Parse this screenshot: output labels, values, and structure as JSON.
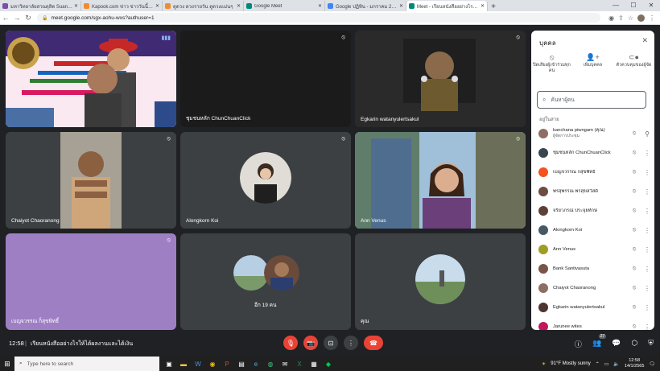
{
  "browser": {
    "tabs": [
      {
        "label": "มหาวิทยาลัยสวนดุสิต Suan Dusit Un",
        "color": "#7b4dad",
        "active": false
      },
      {
        "label": "Kapook.com ข่าว ข่าววันนี้ ดูดวง",
        "color": "#f28b30",
        "active": false
      },
      {
        "label": "ดูดวง ดวงรายวัน ดูดวงแม่นๆ",
        "color": "#f28b30",
        "active": false
      },
      {
        "label": "Google Meet",
        "color": "#00897b",
        "active": false
      },
      {
        "label": "Google ปฏิทิน - มกราคม 2022",
        "color": "#4285f4",
        "active": false
      },
      {
        "label": "Meet - เรียนหนังสืออย่างไรให้ได้ผล",
        "color": "#00897b",
        "active": true
      }
    ],
    "url": "meet.google.com/sgx-aohu-wxs?authuser=1"
  },
  "meeting": {
    "tiles": [
      {
        "name": "",
        "muted": false
      },
      {
        "name": "ชุมชนหลัก ChunChuanClick",
        "muted": true
      },
      {
        "name": "Egkarin watanyulertsakul",
        "muted": true
      },
      {
        "name": "Chaiyot Chaoranong",
        "muted": true
      },
      {
        "name": "Alongkorn Koi",
        "muted": true
      },
      {
        "name": "Ann Venus",
        "muted": true
      },
      {
        "name": "เบญจวรรณ ก็สุขพิทธิ์",
        "muted": true
      },
      {
        "name": "อีก 19 คน",
        "muted": false
      },
      {
        "name": "คุณ",
        "muted": false
      }
    ],
    "time": "12:58",
    "separator": "|",
    "title": "เรียนหนังสืออย่างไรให้ได้ผลงานและได้เงิน",
    "participant_count": "27"
  },
  "panel": {
    "title": "บุคคล",
    "actions": [
      {
        "icon": "mute-all-icon",
        "label": "ปิดเสียงผู้เข้าร่วมทุกคน"
      },
      {
        "icon": "add-person-icon",
        "label": "เพิ่มบุคคล"
      },
      {
        "icon": "host-controls-icon",
        "label": "ตัวควบคุมของผู้จัด"
      }
    ],
    "search_placeholder": "ค้นหาผู้คน",
    "section_label": "อยู่ในสาย",
    "participants": [
      {
        "name": "kanchana piwngam (คุณ)",
        "sub": "ผู้จัดการประชุม",
        "color": "#8d6e63",
        "icon": "pin-icon"
      },
      {
        "name": "ชุมชนหลัก ChunChuanClick",
        "sub": "",
        "color": "#37474f",
        "icon": "more-icon"
      },
      {
        "name": "เบญจวรรณ ก็สุขพิทธิ์",
        "sub": "",
        "color": "#f4511e",
        "icon": "more-icon"
      },
      {
        "name": "พรสุพรรณ พรสุขสวัสดิ์",
        "sub": "",
        "color": "#6d4c41",
        "icon": "more-icon"
      },
      {
        "name": "จริยาภรณ์ ประจุยทักษ์",
        "sub": "",
        "color": "#5d4037",
        "icon": "more-icon"
      },
      {
        "name": "Alongkorn Koi",
        "sub": "",
        "color": "#455a64",
        "icon": "more-icon"
      },
      {
        "name": "Ann Venus",
        "sub": "",
        "color": "#9e9d24",
        "icon": "more-icon"
      },
      {
        "name": "Bank Santivasuta",
        "sub": "",
        "color": "#795548",
        "icon": "more-icon"
      },
      {
        "name": "Chaiyot Chaoranong",
        "sub": "",
        "color": "#8d6e63",
        "icon": "more-icon"
      },
      {
        "name": "Egkarin watanyulertsakul",
        "sub": "",
        "color": "#4e342e",
        "icon": "more-icon"
      },
      {
        "name": "Jarunee wites",
        "sub": "",
        "color": "#c2185b",
        "icon": "more-icon"
      }
    ]
  },
  "taskbar": {
    "search_placeholder": "Type here to search",
    "weather": "91°F  Mostly sunny",
    "time": "12:58",
    "date": "14/1/2565"
  }
}
